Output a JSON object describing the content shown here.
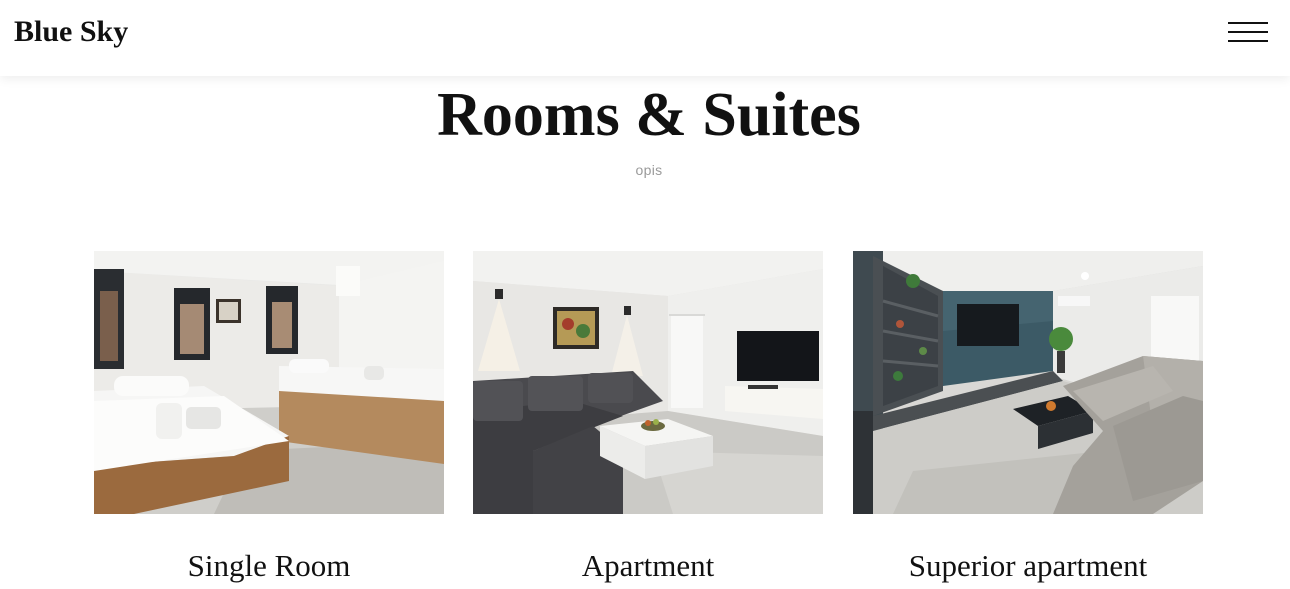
{
  "header": {
    "brand": "Blue Sky",
    "menu_icon": "hamburger-menu-icon"
  },
  "main": {
    "title": "Rooms & Suites",
    "subtitle": "opis",
    "rooms": [
      {
        "name": "Single Room",
        "image": "single-room-photo"
      },
      {
        "name": "Apartment",
        "image": "apartment-photo"
      },
      {
        "name": "Superior apartment",
        "image": "superior-apartment-photo"
      }
    ]
  },
  "colors": {
    "text": "#111111",
    "subtitle": "#9a9a9a",
    "background": "#ffffff"
  }
}
